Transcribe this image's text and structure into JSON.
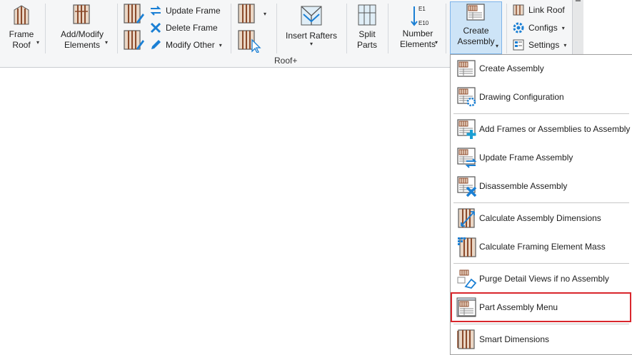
{
  "ribbon": {
    "panel_label": "Roof+",
    "frame_roof": {
      "line1": "Frame",
      "line2": "Roof"
    },
    "add_modify": {
      "line1": "Add/Modify",
      "line2": "Elements"
    },
    "update_frame": "Update Frame",
    "delete_frame": "Delete Frame",
    "modify_other": "Modify Other",
    "insert_rafters": "Insert Rafters",
    "split_parts": {
      "line1": "Split",
      "line2": "Parts"
    },
    "number_elements": {
      "line1": "Number",
      "line2": "Elements",
      "icon_top": "E1",
      "icon_bottom": "E10"
    },
    "create_assembly": {
      "line1": "Create",
      "line2": "Assembly"
    },
    "link_roof": "Link Roof",
    "configs": "Configs",
    "settings": "Settings"
  },
  "menu": {
    "items": [
      {
        "label": "Create Assembly",
        "icon": "assembly-icon"
      },
      {
        "label": "Drawing Configuration",
        "icon": "assembly-gear-icon"
      },
      {
        "label": "Add Frames or Assemblies to Assembly",
        "icon": "assembly-add-icon"
      },
      {
        "label": "Update Frame Assembly",
        "icon": "assembly-update-icon"
      },
      {
        "label": "Disassemble Assembly",
        "icon": "assembly-delete-icon"
      },
      {
        "label": "Calculate Assembly Dimensions",
        "icon": "dimension-icon"
      },
      {
        "label": "Calculate Framing Element Mass",
        "icon": "mass-icon"
      },
      {
        "label": "Purge Detail Views if no Assembly",
        "icon": "purge-icon"
      },
      {
        "label": "Part Assembly Menu",
        "icon": "part-assembly-icon",
        "highlighted": true
      },
      {
        "label": "Smart Dimensions",
        "icon": "smart-dimensions-icon"
      }
    ]
  },
  "colors": {
    "accent_blue": "#1a7fd4",
    "highlight_red": "#d9262c",
    "wood": "#a0522d"
  }
}
